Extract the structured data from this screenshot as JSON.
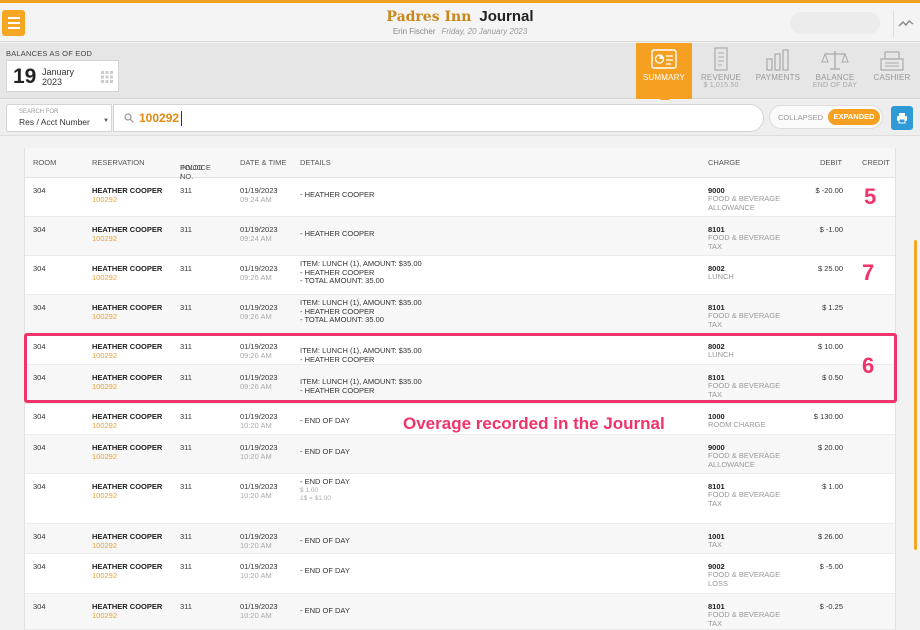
{
  "header": {
    "app_name": "Padres Inn",
    "page_title": "Journal",
    "user": "Erin Fischer",
    "date": "Friday, 20 January 2023"
  },
  "balance": {
    "label": "BALANCES AS OF EOD",
    "day": "19",
    "month": "January",
    "year": "2023"
  },
  "tabs": [
    {
      "label": "SUMMARY",
      "sub": "",
      "icon": "summary-icon",
      "active": true
    },
    {
      "label": "REVENUE",
      "sub": "$ 1,015.50",
      "icon": "receipt-icon",
      "active": false
    },
    {
      "label": "PAYMENTS",
      "sub": "",
      "icon": "bar-chart-icon",
      "active": false
    },
    {
      "label": "BALANCE",
      "sub": "END OF DAY",
      "icon": "scale-icon",
      "active": false
    },
    {
      "label": "CASHIER",
      "sub": "",
      "icon": "register-icon",
      "active": false
    }
  ],
  "search": {
    "for_caption": "SEARCH FOR",
    "for_value": "Res / Acct Number",
    "query": "100292",
    "collapsed": "COLLAPSED",
    "expanded": "EXPANDED"
  },
  "table": {
    "headers": {
      "room": "ROOM",
      "reservation": "RESERVATION",
      "invoice_1": "INVOICE /",
      "invoice_2": "FOLIO NO.",
      "datetime": "DATE & TIME",
      "details": "DETAILS",
      "charge": "CHARGE",
      "debit": "DEBIT",
      "credit": "CREDIT"
    },
    "rows": [
      {
        "room": "304",
        "name": "HEATHER COOPER",
        "res": "100292",
        "invoice": "311",
        "date": "01/19/2023",
        "time": "09:24 AM",
        "details": [
          "- HEATHER COOPER"
        ],
        "code": "9000",
        "desc": [
          "FOOD & BEVERAGE",
          "ALLOWANCE"
        ],
        "debit": "$ -20.00"
      },
      {
        "room": "304",
        "name": "HEATHER COOPER",
        "res": "100292",
        "invoice": "311",
        "date": "01/19/2023",
        "time": "09:24 AM",
        "details": [
          "- HEATHER COOPER"
        ],
        "code": "8101",
        "desc": [
          "FOOD & BEVERAGE",
          "TAX"
        ],
        "debit": "$ -1.00"
      },
      {
        "room": "304",
        "name": "HEATHER COOPER",
        "res": "100292",
        "invoice": "311",
        "date": "01/19/2023",
        "time": "09:26 AM",
        "details": [
          "ITEM: LUNCH (1), AMOUNT: $35.00",
          "- HEATHER COOPER",
          "- TOTAL AMOUNT: 35.00"
        ],
        "code": "8002",
        "desc": [
          "LUNCH"
        ],
        "debit": "$ 25.00"
      },
      {
        "room": "304",
        "name": "HEATHER COOPER",
        "res": "100292",
        "invoice": "311",
        "date": "01/19/2023",
        "time": "09:26 AM",
        "details": [
          "ITEM: LUNCH (1), AMOUNT: $35.00",
          "- HEATHER COOPER",
          "- TOTAL AMOUNT: 35.00"
        ],
        "code": "8101",
        "desc": [
          "FOOD & BEVERAGE",
          "TAX"
        ],
        "debit": "$ 1.25"
      },
      {
        "room": "304",
        "name": "HEATHER COOPER",
        "res": "100292",
        "invoice": "311",
        "date": "01/19/2023",
        "time": "09:26 AM",
        "details": [
          "ITEM: LUNCH (1), AMOUNT: $35.00",
          "- HEATHER COOPER"
        ],
        "code": "8002",
        "desc": [
          "LUNCH"
        ],
        "debit": "$ 10.00"
      },
      {
        "room": "304",
        "name": "HEATHER COOPER",
        "res": "100292",
        "invoice": "311",
        "date": "01/19/2023",
        "time": "09:26 AM",
        "details": [
          "ITEM: LUNCH (1), AMOUNT: $35.00",
          "- HEATHER COOPER"
        ],
        "code": "8101",
        "desc": [
          "FOOD & BEVERAGE",
          "TAX"
        ],
        "debit": "$ 0.50"
      },
      {
        "room": "304",
        "name": "HEATHER COOPER",
        "res": "100292",
        "invoice": "311",
        "date": "01/19/2023",
        "time": "10:20 AM",
        "details": [
          "- END OF DAY"
        ],
        "code": "1000",
        "desc": [
          "ROOM CHARGE"
        ],
        "debit": "$ 130.00"
      },
      {
        "room": "304",
        "name": "HEATHER COOPER",
        "res": "100292",
        "invoice": "311",
        "date": "01/19/2023",
        "time": "10:20 AM",
        "details": [
          "- END OF DAY"
        ],
        "code": "9000",
        "desc": [
          "FOOD & BEVERAGE",
          "ALLOWANCE"
        ],
        "debit": "$ 20.00"
      },
      {
        "room": "304",
        "name": "HEATHER COOPER",
        "res": "100292",
        "invoice": "311",
        "date": "01/19/2023",
        "time": "10:20 AM",
        "details": [
          "- END OF DAY"
        ],
        "detail_sub": [
          "$ 1.00",
          "1$ = $1.00"
        ],
        "code": "8101",
        "desc": [
          "FOOD & BEVERAGE",
          "TAX"
        ],
        "debit": "$ 1.00"
      },
      {
        "room": "304",
        "name": "HEATHER COOPER",
        "res": "100292",
        "invoice": "311",
        "date": "01/19/2023",
        "time": "10:20 AM",
        "details": [
          "- END OF DAY"
        ],
        "code": "1001",
        "desc": [
          "TAX"
        ],
        "debit": "$ 26.00"
      },
      {
        "room": "304",
        "name": "HEATHER COOPER",
        "res": "100292",
        "invoice": "311",
        "date": "01/19/2023",
        "time": "10:20 AM",
        "details": [
          "- END OF DAY"
        ],
        "code": "9002",
        "desc": [
          "FOOD & BEVERAGE",
          "LOSS"
        ],
        "debit": "$ -5.00"
      },
      {
        "room": "304",
        "name": "HEATHER COOPER",
        "res": "100292",
        "invoice": "311",
        "date": "01/19/2023",
        "time": "10:20 AM",
        "details": [
          "- END OF DAY"
        ],
        "code": "8101",
        "desc": [
          "FOOD & BEVERAGE",
          "TAX"
        ],
        "debit": "$ -0.25"
      }
    ]
  },
  "annotations": {
    "n5": "5",
    "n7": "7",
    "n6": "6",
    "overage": "Overage recorded in the Journal"
  },
  "colors": {
    "accent": "#f5a020",
    "annotation": "#f0336a",
    "reservation_link": "#e8a030",
    "print_button": "#2f9bd6"
  }
}
